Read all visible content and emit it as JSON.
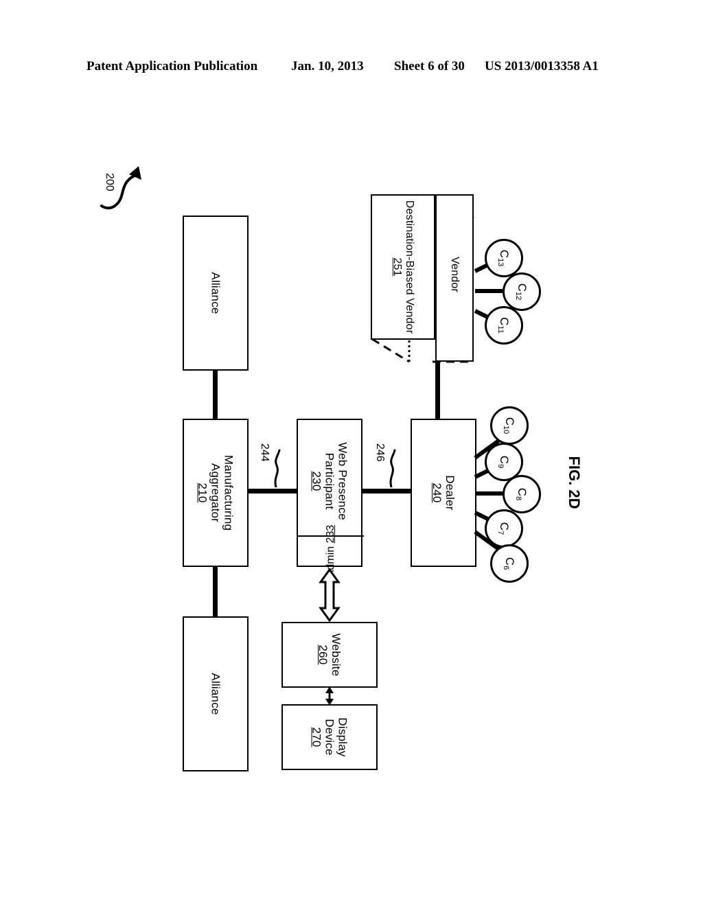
{
  "header": {
    "publication": "Patent Application Publication",
    "date": "Jan. 10, 2013",
    "sheet": "Sheet 6 of 30",
    "pub_number": "US 2013/0013358 A1"
  },
  "figure": {
    "caption": "FIG. 2D",
    "system_ref": "200"
  },
  "nodes": {
    "alliance_top": {
      "label": "Alliance"
    },
    "alliance_bottom": {
      "label": "Alliance"
    },
    "manufacturing_aggregator": {
      "label": "Manufacturing\nAggregator",
      "line1": "Manufacturing",
      "line2": "Aggregator",
      "ref": "210"
    },
    "web_presence_participant": {
      "line1": "Web Presence",
      "line2": "Participant",
      "ref": "230"
    },
    "admin": {
      "label": "Admin",
      "ref": "233"
    },
    "dealer": {
      "label": "Dealer",
      "ref": "240"
    },
    "website": {
      "label": "Website",
      "ref": "260"
    },
    "display_device": {
      "line1": "Display",
      "line2": "Device",
      "ref": "270"
    },
    "destination_biased_vendor": {
      "label": "Destination-Biased Vendor",
      "ref": "251"
    },
    "vendor": {
      "label": "Vendor"
    }
  },
  "links": {
    "link_244": "244",
    "link_246": "246"
  },
  "customers": {
    "dealer_customers": [
      {
        "id": "C10",
        "base": "C",
        "sub": "10"
      },
      {
        "id": "C9",
        "base": "C",
        "sub": "9"
      },
      {
        "id": "C8",
        "base": "C",
        "sub": "8"
      },
      {
        "id": "C7",
        "base": "C",
        "sub": "7"
      },
      {
        "id": "C6",
        "base": "C",
        "sub": "6"
      }
    ],
    "vendor_customers": [
      {
        "id": "C13",
        "base": "C",
        "sub": "13"
      },
      {
        "id": "C12",
        "base": "C",
        "sub": "12"
      },
      {
        "id": "C11",
        "base": "C",
        "sub": "11"
      }
    ]
  },
  "colors": {
    "line": "#000000",
    "background": "#ffffff"
  }
}
